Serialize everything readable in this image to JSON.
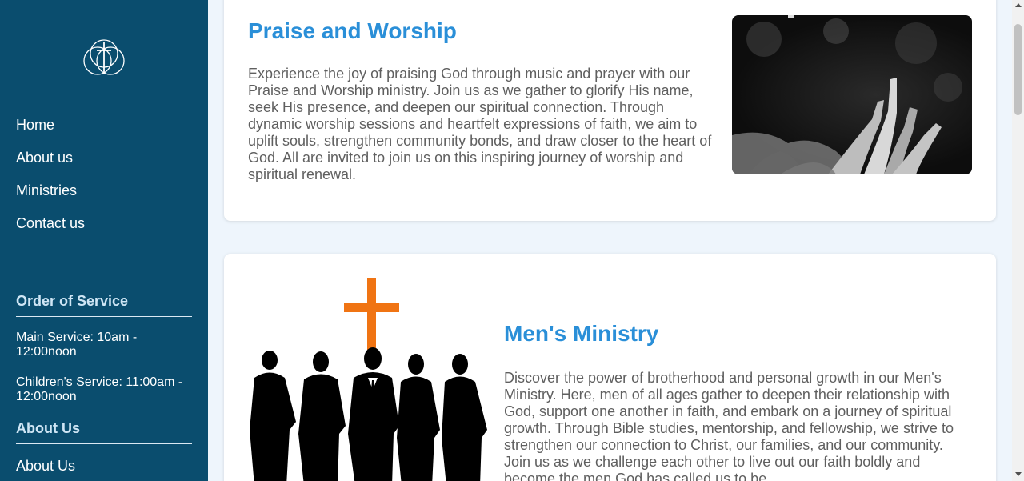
{
  "sidebar": {
    "logo_icon": "cross-circles-logo",
    "nav": [
      "Home",
      "About us",
      "Ministries",
      "Contact us"
    ],
    "order_of_service": {
      "heading": "Order of Service",
      "main_service": "Main Service: 10am - 12:00noon",
      "children_service": "Children's Service: 11:00am - 12:00noon"
    },
    "about": {
      "heading": "About Us",
      "link": "About Us"
    }
  },
  "main": {
    "praise": {
      "title": "Praise and Worship",
      "description": "Experience the joy of praising God through music and prayer with our Praise and Worship ministry. Join us as we gather to glorify His name, seek His presence, and deepen our spiritual connection. Through dynamic worship sessions and heartfelt expressions of faith, we aim to uplift souls, strengthen community bonds, and draw closer to the heart of God. All are invited to join us on this inspiring journey of worship and spiritual renewal."
    },
    "mens": {
      "title": "Men's Ministry",
      "description": "Discover the power of brotherhood and personal growth in our Men's Ministry. Here, men of all ages gather to deepen their relationship with God, support one another in faith, and embark on a journey of spiritual growth. Through Bible studies, mentorship, and fellowship, we strive to strengthen our connection to Christ, our families, and our community. Join us as we challenge each other to live out our faith boldly and become the men God has called us to be."
    }
  },
  "colors": {
    "sidebar_bg": "#0a4d6e",
    "accent": "#2a8fd8",
    "cross": "#f07413",
    "page_bg": "#eef5fc"
  }
}
